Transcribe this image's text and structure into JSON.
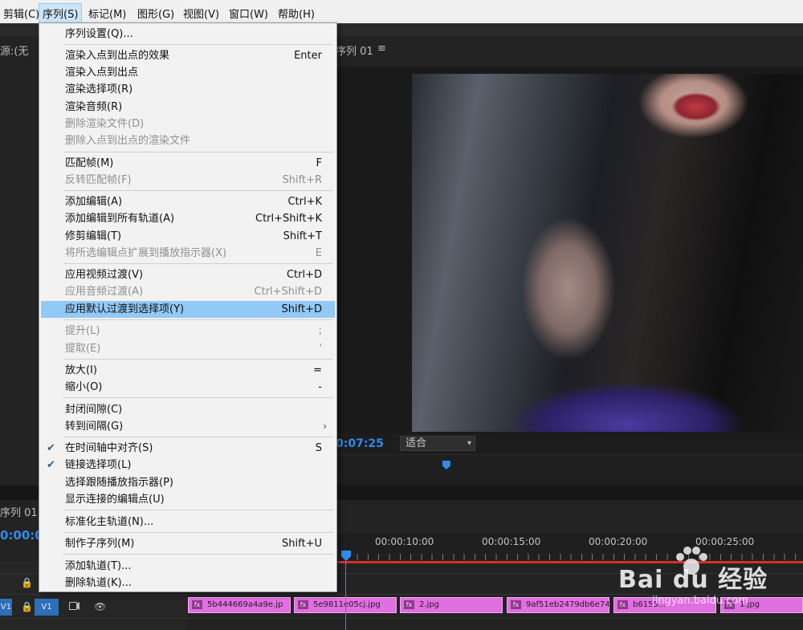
{
  "menubar": {
    "items": [
      {
        "label": "剪辑(C)"
      },
      {
        "label": "序列(S)"
      },
      {
        "label": "标记(M)"
      },
      {
        "label": "图形(G)"
      },
      {
        "label": "视图(V)"
      },
      {
        "label": "窗口(W)"
      },
      {
        "label": "帮助(H)"
      }
    ]
  },
  "source_panel": {
    "tab": "源:(无"
  },
  "program_monitor": {
    "tab": "序列 01",
    "menu_glyph": "≡",
    "timecode": "0:07:25",
    "fit_value": "适合",
    "playhead_fraction": 0.237
  },
  "sequence_menu": {
    "items": [
      {
        "label": "序列设置(Q)...",
        "shortcut": "",
        "enabled": true
      },
      {
        "label": "渲染入点到出点的效果",
        "shortcut": "Enter",
        "enabled": true
      },
      {
        "label": "渲染入点到出点",
        "shortcut": "",
        "enabled": true
      },
      {
        "label": "渲染选择项(R)",
        "shortcut": "",
        "enabled": true
      },
      {
        "label": "渲染音频(R)",
        "shortcut": "",
        "enabled": true
      },
      {
        "label": "删除渲染文件(D)",
        "shortcut": "",
        "enabled": false
      },
      {
        "label": "删除入点到出点的渲染文件",
        "shortcut": "",
        "enabled": false
      },
      {
        "label": "匹配帧(M)",
        "shortcut": "F",
        "enabled": true
      },
      {
        "label": "反转匹配帧(F)",
        "shortcut": "Shift+R",
        "enabled": false
      },
      {
        "label": "添加编辑(A)",
        "shortcut": "Ctrl+K",
        "enabled": true
      },
      {
        "label": "添加编辑到所有轨道(A)",
        "shortcut": "Ctrl+Shift+K",
        "enabled": true
      },
      {
        "label": "修剪编辑(T)",
        "shortcut": "Shift+T",
        "enabled": true
      },
      {
        "label": "将所选编辑点扩展到播放指示器(X)",
        "shortcut": "E",
        "enabled": false
      },
      {
        "label": "应用视频过渡(V)",
        "shortcut": "Ctrl+D",
        "enabled": true
      },
      {
        "label": "应用音频过渡(A)",
        "shortcut": "Ctrl+Shift+D",
        "enabled": false
      },
      {
        "label": "应用默认过渡到选择项(Y)",
        "shortcut": "Shift+D",
        "enabled": true,
        "highlighted": true
      },
      {
        "label": "提升(L)",
        "shortcut": ";",
        "enabled": false
      },
      {
        "label": "提取(E)",
        "shortcut": "'",
        "enabled": false
      },
      {
        "label": "放大(I)",
        "shortcut": "=",
        "enabled": true
      },
      {
        "label": "缩小(O)",
        "shortcut": "-",
        "enabled": true
      },
      {
        "label": "封闭间隙(C)",
        "shortcut": "",
        "enabled": true
      },
      {
        "label": "转到间隔(G)",
        "shortcut": "",
        "enabled": true,
        "submenu": true
      },
      {
        "label": "在时间轴中对齐(S)",
        "shortcut": "S",
        "enabled": true,
        "checked": true
      },
      {
        "label": "链接选择项(L)",
        "shortcut": "",
        "enabled": true,
        "checked": true
      },
      {
        "label": "选择跟随播放指示器(P)",
        "shortcut": "",
        "enabled": true
      },
      {
        "label": "显示连接的编辑点(U)",
        "shortcut": "",
        "enabled": true
      },
      {
        "label": "标准化主轨道(N)...",
        "shortcut": "",
        "enabled": true
      },
      {
        "label": "制作子序列(M)",
        "shortcut": "Shift+U",
        "enabled": true
      },
      {
        "label": "添加轨道(T)...",
        "shortcut": "",
        "enabled": true
      },
      {
        "label": "删除轨道(K)...",
        "shortcut": "",
        "enabled": true
      }
    ]
  },
  "timeline": {
    "tab": "序列 01",
    "timecode": "0:00:0",
    "ruler_ticks": [
      "00:00:10:00",
      "00:00:15:00",
      "00:00:20:00",
      "00:00:25:00"
    ],
    "track_label_left": "V1",
    "track_label_target": "V1",
    "clips": [
      {
        "name": "5b444669a4a9e.jp"
      },
      {
        "name": "5e9811e05cj.jpg"
      },
      {
        "name": "2.jpg"
      },
      {
        "name": "9af51eb2479db6e74"
      },
      {
        "name": "b6155..."
      },
      {
        "name": "1.jpg"
      }
    ],
    "fx_badge": "fx"
  },
  "watermark": {
    "brand": "Bai du 经验",
    "url": "jingyan.baidu.com"
  },
  "icons": {
    "check": "✔",
    "submenu_arrow": "›",
    "lock": "🔒",
    "eye": "👁",
    "dropdown_arrow": "▾"
  }
}
